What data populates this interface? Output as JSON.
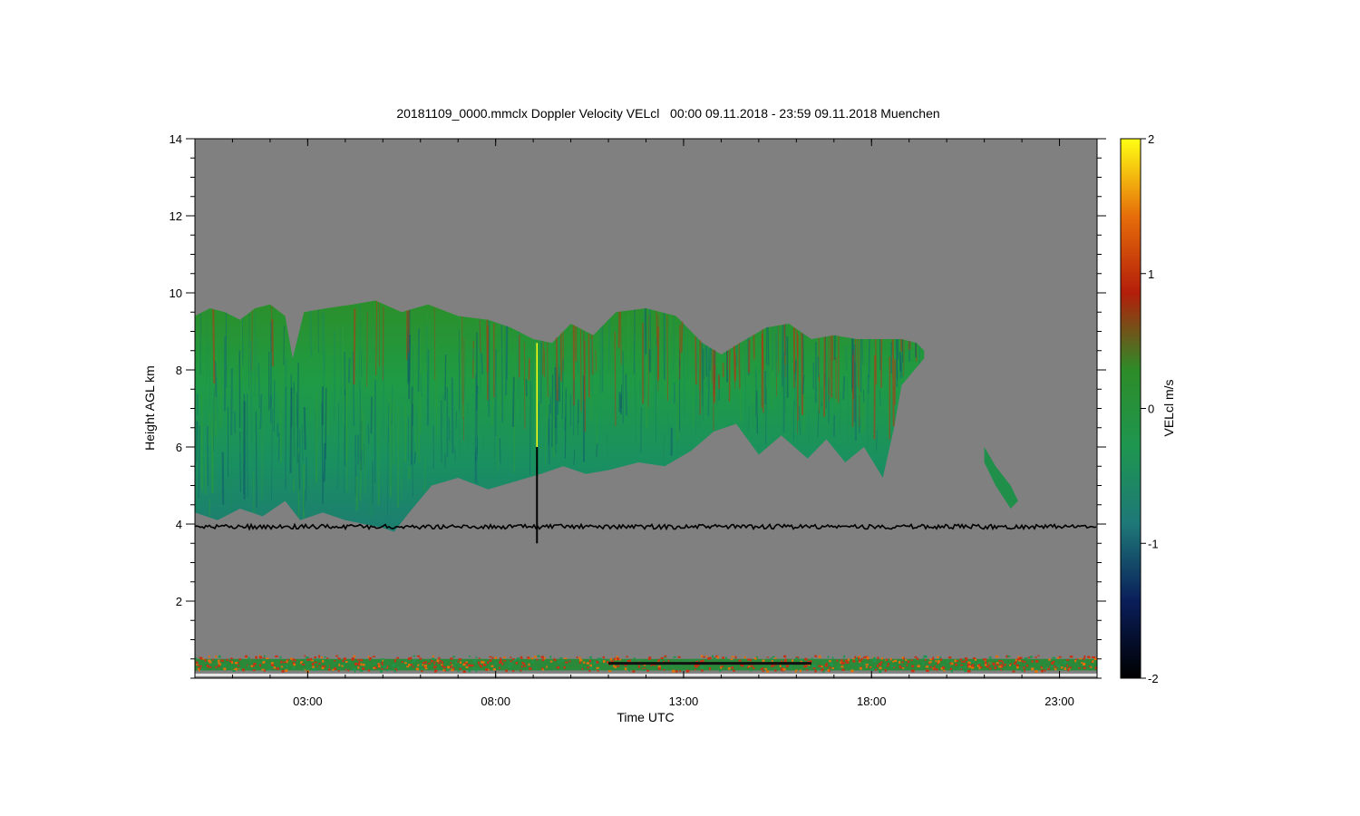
{
  "chart_data": {
    "type": "heatmap",
    "title": "20181109_0000.mmclx Doppler Velocity VELcl   00:00 09.11.2018 - 23:59 09.11.2018 Muenchen",
    "xlabel": "Time UTC",
    "ylabel": "Height AGL km",
    "colorbar_label": "VELcl m/s",
    "xlim": [
      0,
      24
    ],
    "ylim": [
      0,
      14
    ],
    "x_ticks": [
      {
        "value": 3,
        "label": "03:00"
      },
      {
        "value": 8,
        "label": "08:00"
      },
      {
        "value": 13,
        "label": "13:00"
      },
      {
        "value": 18,
        "label": "18:00"
      },
      {
        "value": 23,
        "label": "23:00"
      }
    ],
    "y_ticks": [
      {
        "value": 2,
        "label": "2"
      },
      {
        "value": 4,
        "label": "4"
      },
      {
        "value": 6,
        "label": "6"
      },
      {
        "value": 8,
        "label": "8"
      },
      {
        "value": 10,
        "label": "10"
      },
      {
        "value": 12,
        "label": "12"
      },
      {
        "value": 14,
        "label": "14"
      }
    ],
    "colorbar_range": [
      -2,
      2
    ],
    "colorbar_ticks": [
      {
        "value": 2,
        "label": "2"
      },
      {
        "value": 1,
        "label": "1"
      },
      {
        "value": 0,
        "label": "0"
      },
      {
        "value": -1,
        "label": "-1"
      },
      {
        "value": -2,
        "label": "-2"
      }
    ],
    "colorscale": [
      "#000000",
      "#0a1e5a",
      "#1e7878",
      "#1e9650",
      "#2d8c28",
      "#b41e0a",
      "#e66e0a",
      "#ffff14"
    ],
    "background_color": "#808080",
    "cloud_layer": {
      "top_profile": [
        [
          0.0,
          9.4
        ],
        [
          0.4,
          9.6
        ],
        [
          0.8,
          9.5
        ],
        [
          1.2,
          9.3
        ],
        [
          1.6,
          9.6
        ],
        [
          2.0,
          9.7
        ],
        [
          2.4,
          9.4
        ],
        [
          2.6,
          8.3
        ],
        [
          2.9,
          9.5
        ],
        [
          3.5,
          9.6
        ],
        [
          4.2,
          9.7
        ],
        [
          4.8,
          9.8
        ],
        [
          5.5,
          9.5
        ],
        [
          6.2,
          9.7
        ],
        [
          7.0,
          9.4
        ],
        [
          7.8,
          9.3
        ],
        [
          8.4,
          9.1
        ],
        [
          9.0,
          8.8
        ],
        [
          9.5,
          8.7
        ],
        [
          10.0,
          9.2
        ],
        [
          10.6,
          8.9
        ],
        [
          11.2,
          9.5
        ],
        [
          12.0,
          9.6
        ],
        [
          12.8,
          9.4
        ],
        [
          13.5,
          8.7
        ],
        [
          14.0,
          8.4
        ],
        [
          14.5,
          8.7
        ],
        [
          15.2,
          9.1
        ],
        [
          15.8,
          9.2
        ],
        [
          16.4,
          8.8
        ],
        [
          17.0,
          8.9
        ],
        [
          17.6,
          8.8
        ],
        [
          18.2,
          8.8
        ],
        [
          18.8,
          8.8
        ],
        [
          19.2,
          8.7
        ],
        [
          19.4,
          8.5
        ]
      ],
      "base_profile": [
        [
          19.4,
          8.3
        ],
        [
          18.8,
          7.6
        ],
        [
          18.6,
          6.5
        ],
        [
          18.3,
          5.2
        ],
        [
          17.8,
          6.0
        ],
        [
          17.3,
          5.6
        ],
        [
          16.8,
          6.2
        ],
        [
          16.3,
          5.7
        ],
        [
          15.6,
          6.3
        ],
        [
          15.0,
          5.8
        ],
        [
          14.4,
          6.6
        ],
        [
          13.8,
          6.4
        ],
        [
          13.2,
          5.9
        ],
        [
          12.5,
          5.5
        ],
        [
          11.8,
          5.6
        ],
        [
          11.0,
          5.4
        ],
        [
          10.4,
          5.3
        ],
        [
          9.8,
          5.5
        ],
        [
          9.2,
          5.3
        ],
        [
          8.5,
          5.1
        ],
        [
          7.8,
          4.9
        ],
        [
          7.0,
          5.2
        ],
        [
          6.3,
          5.0
        ],
        [
          5.7,
          4.3
        ],
        [
          5.3,
          3.8
        ],
        [
          5.0,
          3.9
        ],
        [
          4.5,
          4.0
        ],
        [
          4.0,
          4.1
        ],
        [
          3.4,
          4.3
        ],
        [
          2.8,
          4.1
        ],
        [
          2.4,
          4.6
        ],
        [
          1.8,
          4.2
        ],
        [
          1.2,
          4.4
        ],
        [
          0.6,
          4.1
        ],
        [
          0.0,
          4.3
        ]
      ],
      "velocity": -0.4
    },
    "small_cloud": {
      "outline": [
        [
          21.0,
          6.0
        ],
        [
          21.3,
          5.5
        ],
        [
          21.7,
          5.0
        ],
        [
          21.9,
          4.6
        ],
        [
          21.7,
          4.4
        ],
        [
          21.3,
          5.0
        ],
        [
          21.0,
          5.6
        ]
      ],
      "velocity": -0.5
    },
    "noise_line": {
      "height": 3.93,
      "x_range": [
        0,
        24
      ]
    },
    "spike": {
      "x": 9.1,
      "y_range": [
        3.5,
        8.7
      ]
    },
    "surface_clutter": {
      "height_range": [
        0.2,
        0.5
      ]
    }
  }
}
